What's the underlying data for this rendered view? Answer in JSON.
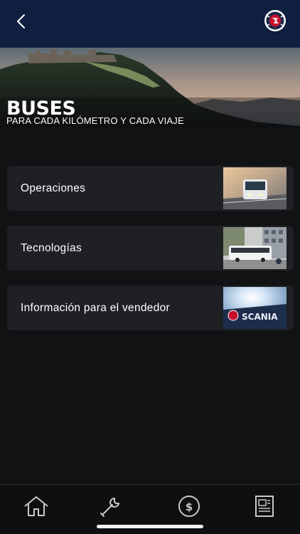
{
  "header": {
    "back_icon": "chevron-left-icon",
    "logo_icon": "scania-griffin-logo-icon"
  },
  "hero": {
    "title": "BUSES",
    "subtitle": "PARA CADA KILÓMETRO Y CADA VIAJE"
  },
  "menu": {
    "items": [
      {
        "label": "Operaciones",
        "thumb": "bus-on-road-image"
      },
      {
        "label": "Tecnologías",
        "thumb": "city-bus-image"
      },
      {
        "label": "Información para el vendedor",
        "thumb": "scania-sign-image"
      }
    ]
  },
  "bottom_nav": {
    "items": [
      {
        "icon": "home-icon"
      },
      {
        "icon": "wrench-icon"
      },
      {
        "icon": "dollar-icon"
      },
      {
        "icon": "document-icon"
      }
    ]
  },
  "colors": {
    "topbar": "#0e1f3f",
    "background": "#111214",
    "card": "#1e2024",
    "nav": "#0e0f11"
  }
}
